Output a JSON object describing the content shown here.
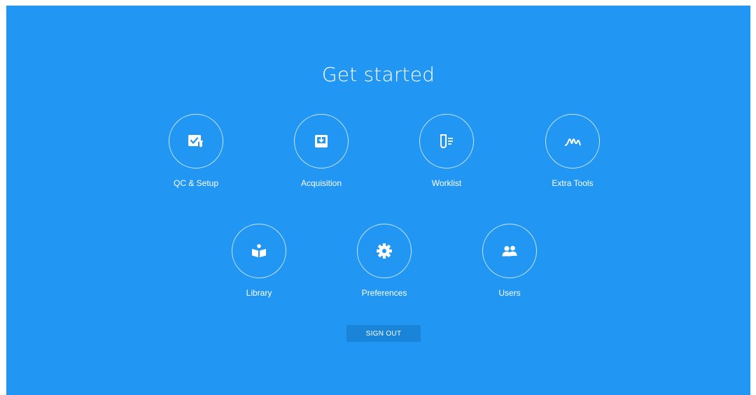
{
  "page": {
    "title": "Get started",
    "background_color": "#2196f3",
    "accent_button_color": "#1a84d8"
  },
  "tiles": [
    {
      "label": "QC & Setup",
      "icon": "qc-setup-icon"
    },
    {
      "label": "Acquisition",
      "icon": "acquisition-icon"
    },
    {
      "label": "Worklist",
      "icon": "worklist-icon"
    },
    {
      "label": "Extra Tools",
      "icon": "extra-tools-icon"
    },
    {
      "label": "Library",
      "icon": "library-icon"
    },
    {
      "label": "Preferences",
      "icon": "gear-icon"
    },
    {
      "label": "Users",
      "icon": "users-icon"
    }
  ],
  "actions": {
    "sign_out_label": "SIGN OUT"
  }
}
